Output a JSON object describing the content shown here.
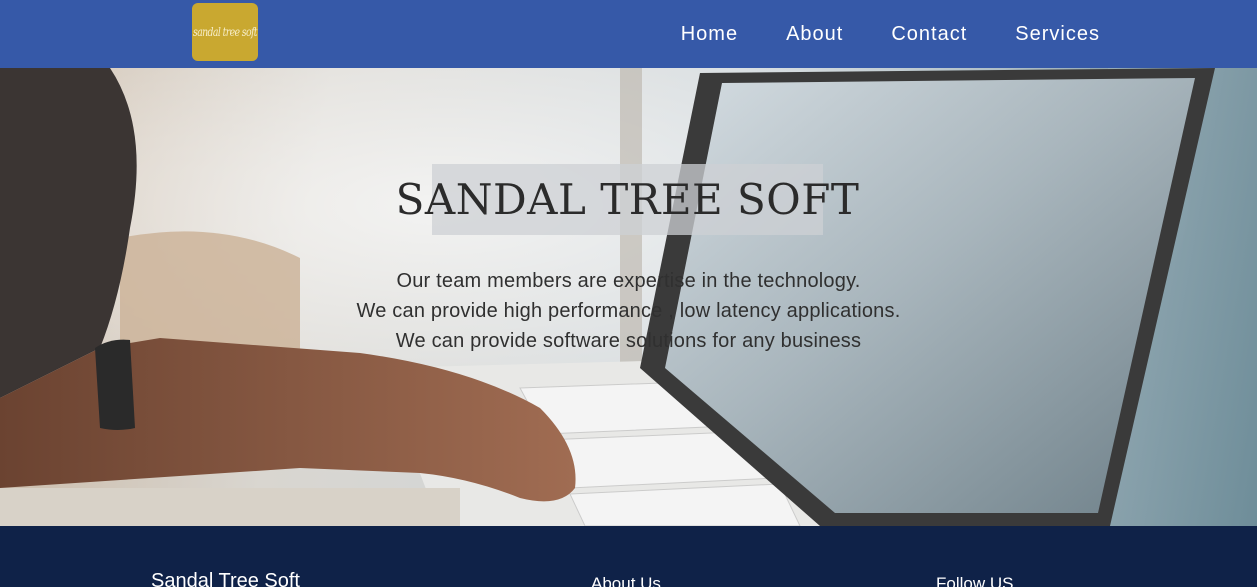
{
  "header": {
    "logo_text": "sandal tree soft",
    "nav": [
      "Home",
      "About",
      "Contact",
      "Services"
    ]
  },
  "hero": {
    "title": "SANDAL TREE SOFT",
    "lines": [
      "Our team members are expertise in the technology.",
      "We can provide high performance , low latency applications.",
      "We can provide software solutions for any business"
    ]
  },
  "footer": {
    "brand": "Sandal Tree Soft",
    "about_heading": "About Us",
    "follow_heading": "Follow US"
  },
  "colors": {
    "header_bg": "#3659a8",
    "logo_bg": "#c9a830",
    "footer_bg": "#0f2248"
  }
}
